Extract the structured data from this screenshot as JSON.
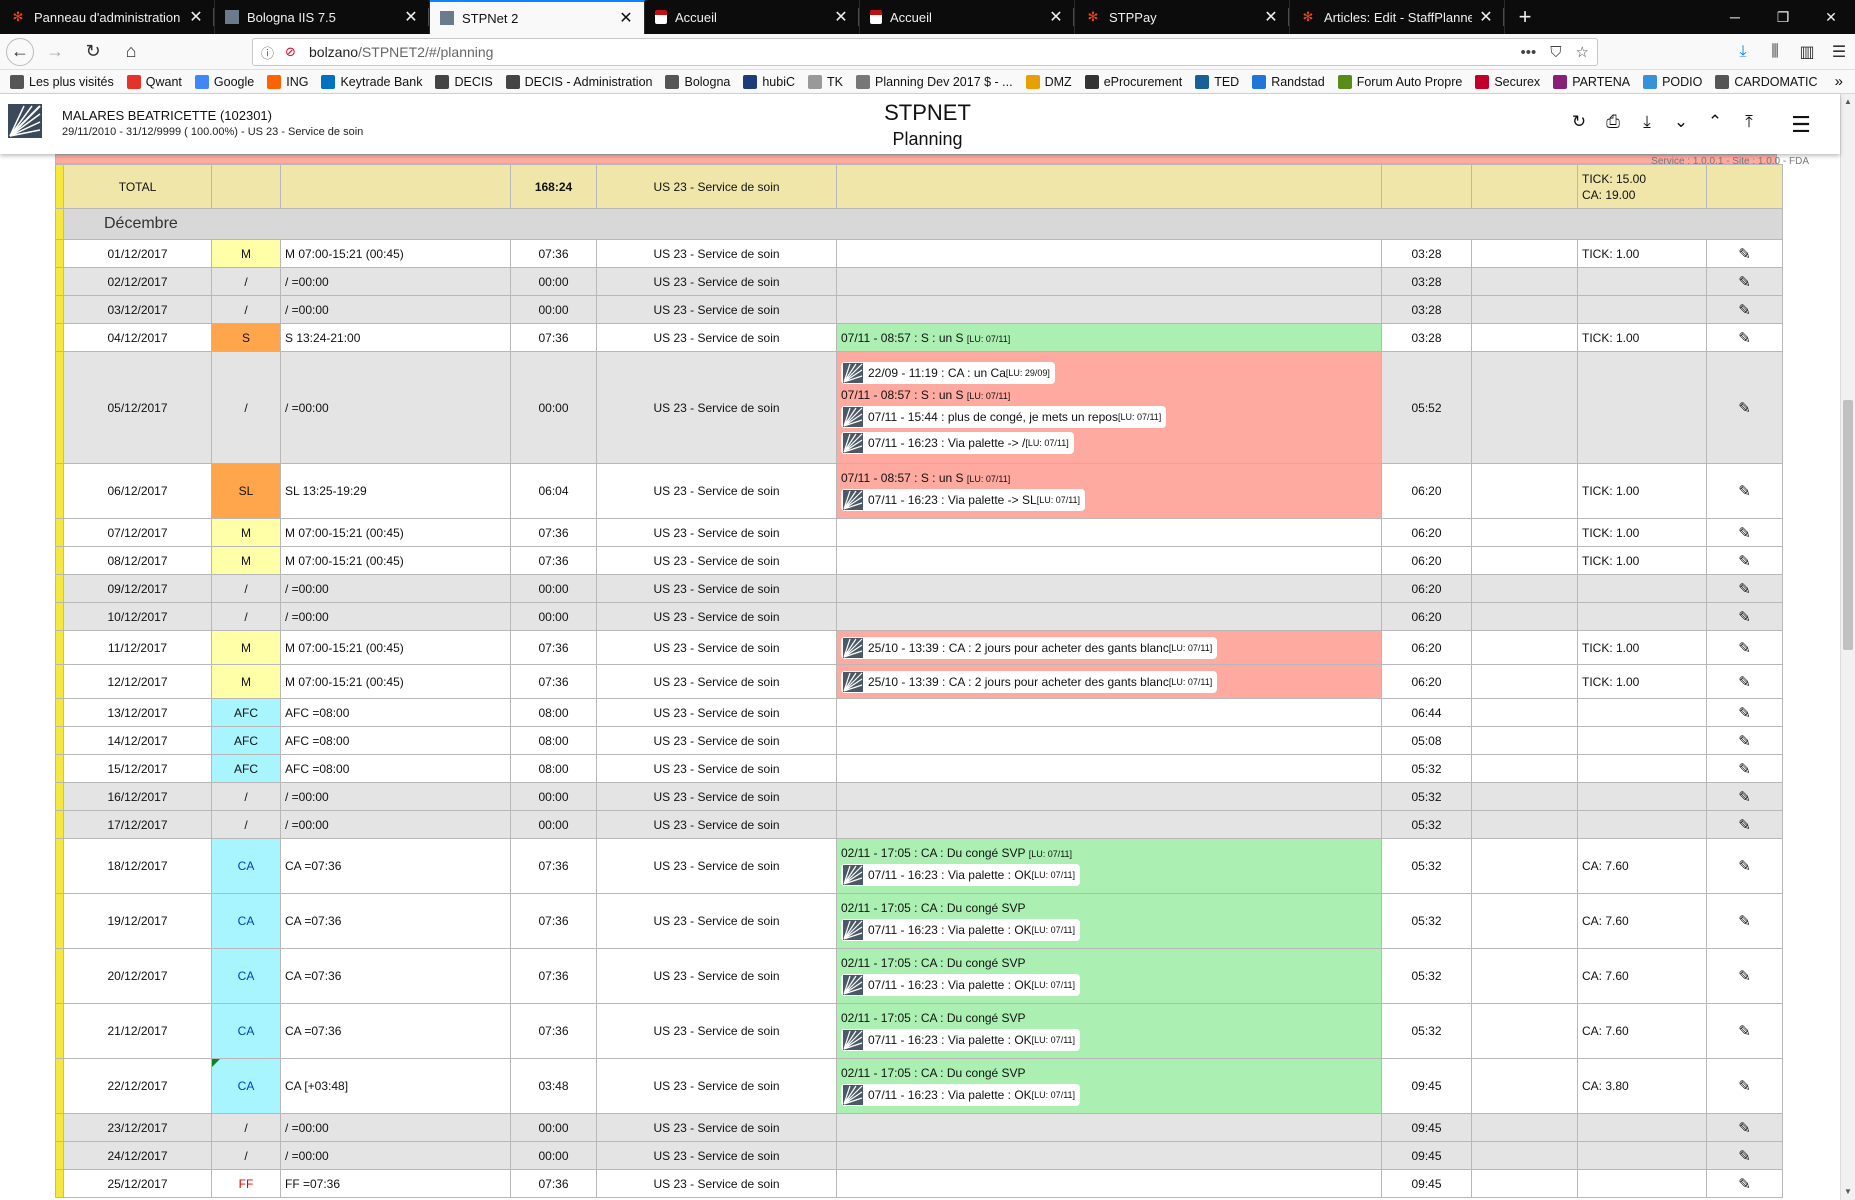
{
  "browser": {
    "tabs": [
      {
        "title": "Panneau d'administration - DEC",
        "icon": "joomla-icon"
      },
      {
        "title": "Bologna IIS 7.5",
        "icon": "bologna-icon"
      },
      {
        "title": "STPNet 2",
        "icon": "stpnet-icon",
        "active": true
      },
      {
        "title": "Accueil",
        "icon": "page-icon"
      },
      {
        "title": "Accueil",
        "icon": "page-icon"
      },
      {
        "title": "STPPay",
        "icon": "joomla-icon"
      },
      {
        "title": "Articles: Edit - StaffPlanner - Ad",
        "icon": "joomla-icon"
      }
    ],
    "url": "bolzano/STPNET2/#/planning",
    "url_host": "bolzano",
    "url_path": "/STPNET2/#/planning",
    "bookmarks": [
      {
        "label": "Les plus visités",
        "color": "#555"
      },
      {
        "label": "Qwant",
        "color": "#e6332a"
      },
      {
        "label": "Google",
        "color": "#4285f4"
      },
      {
        "label": "ING",
        "color": "#ff6200"
      },
      {
        "label": "Keytrade Bank",
        "color": "#0070c0"
      },
      {
        "label": "DECIS",
        "color": "#444"
      },
      {
        "label": "DECIS - Administration",
        "color": "#444"
      },
      {
        "label": "Bologna",
        "color": "#555"
      },
      {
        "label": "hubiC",
        "color": "#1e3a78"
      },
      {
        "label": "TK",
        "color": "#999"
      },
      {
        "label": "Planning Dev 2017 $ - ...",
        "color": "#777"
      },
      {
        "label": "DMZ",
        "color": "#e8a000"
      },
      {
        "label": "eProcurement",
        "color": "#333"
      },
      {
        "label": "TED",
        "color": "#1a5e9a"
      },
      {
        "label": "Randstad",
        "color": "#2175d9"
      },
      {
        "label": "Forum Auto Propre",
        "color": "#5a8a1a"
      },
      {
        "label": "Securex",
        "color": "#c0002a"
      },
      {
        "label": "PARTENA",
        "color": "#8a1f7a"
      },
      {
        "label": "PODIO",
        "color": "#3a8fd9"
      },
      {
        "label": "CARDOMATIC",
        "color": "#555"
      }
    ]
  },
  "header": {
    "employee_name": "MALARES BEATRICETTE (102301)",
    "employee_info": "29/11/2010 - 31/12/9999 ( 100.00%) - US 23 - Service de soin",
    "title": "STPNET",
    "subtitle": "Planning",
    "version": "Service : 1.0.0.1 - Site : 1.0.0 - FDA"
  },
  "total": {
    "label": "TOTAL",
    "hours": "168:24",
    "service": "US 23 - Service de soin",
    "balance_line1": "TICK: 15.00",
    "balance_line2": "CA: 19.00"
  },
  "month": "Décembre",
  "rows": [
    {
      "date": "01/12/2017",
      "code": "M",
      "schedule": "M 07:00-15:21 (00:45)",
      "hours": "07:36",
      "service": "US 23 - Service de soin",
      "comments": [],
      "counter": "03:28",
      "balance": "TICK: 1.00"
    },
    {
      "date": "02/12/2017",
      "code": "/",
      "schedule": "/ =00:00",
      "hours": "00:00",
      "service": "US 23 - Service de soin",
      "comments": [],
      "counter": "03:28",
      "balance": ""
    },
    {
      "date": "03/12/2017",
      "code": "/",
      "schedule": "/ =00:00",
      "hours": "00:00",
      "service": "US 23 - Service de soin",
      "comments": [],
      "counter": "03:28",
      "balance": ""
    },
    {
      "date": "04/12/2017",
      "code": "S",
      "schedule": "S 13:24-21:00",
      "hours": "07:36",
      "service": "US 23 - Service de soin",
      "comments": [
        {
          "text": "07/11 - 08:57 : S : un S",
          "lu": "[LU: 07/11]",
          "pill": false
        }
      ],
      "counter": "03:28",
      "balance": "TICK: 1.00"
    },
    {
      "date": "05/12/2017",
      "code": "/",
      "schedule": "/ =00:00",
      "hours": "00:00",
      "service": "US 23 - Service de soin",
      "comments": [
        {
          "text": "22/09 - 11:19 : CA : un Ca",
          "lu": "[LU: 29/09]",
          "pill": true
        },
        {
          "text": "07/11 - 08:57 : S : un S",
          "lu": "[LU: 07/11]",
          "pill": false
        },
        {
          "text": "07/11 - 15:44 : plus de congé, je mets un repos",
          "lu": "[LU: 07/11]",
          "pill": true
        },
        {
          "text": "07/11 - 16:23 : Via palette -> /",
          "lu": "[LU: 07/11]",
          "pill": true
        }
      ],
      "counter": "05:52",
      "balance": ""
    },
    {
      "date": "06/12/2017",
      "code": "SL",
      "schedule": "SL 13:25-19:29",
      "hours": "06:04",
      "service": "US 23 - Service de soin",
      "comments": [
        {
          "text": "07/11 - 08:57 : S : un S",
          "lu": "[LU: 07/11]",
          "pill": false
        },
        {
          "text": "07/11 - 16:23 : Via palette -> SL",
          "lu": "[LU: 07/11]",
          "pill": true
        }
      ],
      "counter": "06:20",
      "balance": "TICK: 1.00"
    },
    {
      "date": "07/12/2017",
      "code": "M",
      "schedule": "M 07:00-15:21 (00:45)",
      "hours": "07:36",
      "service": "US 23 - Service de soin",
      "comments": [],
      "counter": "06:20",
      "balance": "TICK: 1.00"
    },
    {
      "date": "08/12/2017",
      "code": "M",
      "schedule": "M 07:00-15:21 (00:45)",
      "hours": "07:36",
      "service": "US 23 - Service de soin",
      "comments": [],
      "counter": "06:20",
      "balance": "TICK: 1.00"
    },
    {
      "date": "09/12/2017",
      "code": "/",
      "schedule": "/ =00:00",
      "hours": "00:00",
      "service": "US 23 - Service de soin",
      "comments": [],
      "counter": "06:20",
      "balance": ""
    },
    {
      "date": "10/12/2017",
      "code": "/",
      "schedule": "/ =00:00",
      "hours": "00:00",
      "service": "US 23 - Service de soin",
      "comments": [],
      "counter": "06:20",
      "balance": ""
    },
    {
      "date": "11/12/2017",
      "code": "M",
      "schedule": "M 07:00-15:21 (00:45)",
      "hours": "07:36",
      "service": "US 23 - Service de soin",
      "comments": [
        {
          "text": "25/10 - 13:39 : CA : 2 jours pour acheter des gants blanc",
          "lu": "[LU: 07/11]",
          "pill": true
        }
      ],
      "counter": "06:20",
      "balance": "TICK: 1.00"
    },
    {
      "date": "12/12/2017",
      "code": "M",
      "schedule": "M 07:00-15:21 (00:45)",
      "hours": "07:36",
      "service": "US 23 - Service de soin",
      "comments": [
        {
          "text": "25/10 - 13:39 : CA : 2 jours pour acheter des gants blanc",
          "lu": "[LU: 07/11]",
          "pill": true
        }
      ],
      "counter": "06:20",
      "balance": "TICK: 1.00"
    },
    {
      "date": "13/12/2017",
      "code": "AFC",
      "schedule": "AFC =08:00",
      "hours": "08:00",
      "service": "US 23 - Service de soin",
      "comments": [],
      "counter": "06:44",
      "balance": ""
    },
    {
      "date": "14/12/2017",
      "code": "AFC",
      "schedule": "AFC =08:00",
      "hours": "08:00",
      "service": "US 23 - Service de soin",
      "comments": [],
      "counter": "05:08",
      "balance": ""
    },
    {
      "date": "15/12/2017",
      "code": "AFC",
      "schedule": "AFC =08:00",
      "hours": "08:00",
      "service": "US 23 - Service de soin",
      "comments": [],
      "counter": "05:32",
      "balance": ""
    },
    {
      "date": "16/12/2017",
      "code": "/",
      "schedule": "/ =00:00",
      "hours": "00:00",
      "service": "US 23 - Service de soin",
      "comments": [],
      "counter": "05:32",
      "balance": ""
    },
    {
      "date": "17/12/2017",
      "code": "/",
      "schedule": "/ =00:00",
      "hours": "00:00",
      "service": "US 23 - Service de soin",
      "comments": [],
      "counter": "05:32",
      "balance": ""
    },
    {
      "date": "18/12/2017",
      "code": "CA",
      "schedule": "CA =07:36",
      "hours": "07:36",
      "service": "US 23 - Service de soin",
      "comments": [
        {
          "text": "02/11 - 17:05 : CA : Du congé SVP",
          "lu": "[LU: 07/11]",
          "pill": false
        },
        {
          "text": "07/11 - 16:23 : Via palette : OK",
          "lu": "[LU: 07/11]",
          "pill": true
        }
      ],
      "counter": "05:32",
      "balance": "CA: 7.60"
    },
    {
      "date": "19/12/2017",
      "code": "CA",
      "schedule": "CA =07:36",
      "hours": "07:36",
      "service": "US 23 - Service de soin",
      "comments": [
        {
          "text": "02/11 - 17:05 : CA : Du congé SVP",
          "lu": "",
          "pill": false
        },
        {
          "text": "07/11 - 16:23 : Via palette : OK",
          "lu": "[LU: 07/11]",
          "pill": true
        }
      ],
      "counter": "05:32",
      "balance": "CA: 7.60"
    },
    {
      "date": "20/12/2017",
      "code": "CA",
      "schedule": "CA =07:36",
      "hours": "07:36",
      "service": "US 23 - Service de soin",
      "comments": [
        {
          "text": "02/11 - 17:05 : CA : Du congé SVP",
          "lu": "",
          "pill": false
        },
        {
          "text": "07/11 - 16:23 : Via palette : OK",
          "lu": "[LU: 07/11]",
          "pill": true
        }
      ],
      "counter": "05:32",
      "balance": "CA: 7.60"
    },
    {
      "date": "21/12/2017",
      "code": "CA",
      "schedule": "CA =07:36",
      "hours": "07:36",
      "service": "US 23 - Service de soin",
      "comments": [
        {
          "text": "02/11 - 17:05 : CA : Du congé SVP",
          "lu": "",
          "pill": false
        },
        {
          "text": "07/11 - 16:23 : Via palette : OK",
          "lu": "[LU: 07/11]",
          "pill": true
        }
      ],
      "counter": "05:32",
      "balance": "CA: 7.60"
    },
    {
      "date": "22/12/2017",
      "code": "CA",
      "schedule": "CA [+03:48]",
      "hours": "03:48",
      "service": "US 23 - Service de soin",
      "comments": [
        {
          "text": "02/11 - 17:05 : CA : Du congé SVP",
          "lu": "",
          "pill": false
        },
        {
          "text": "07/11 - 16:23 : Via palette : OK",
          "lu": "[LU: 07/11]",
          "pill": true
        }
      ],
      "counter": "09:45",
      "balance": "CA: 3.80",
      "flag": true
    },
    {
      "date": "23/12/2017",
      "code": "/",
      "schedule": "/ =00:00",
      "hours": "00:00",
      "service": "US 23 - Service de soin",
      "comments": [],
      "counter": "09:45",
      "balance": ""
    },
    {
      "date": "24/12/2017",
      "code": "/",
      "schedule": "/ =00:00",
      "hours": "00:00",
      "service": "US 23 - Service de soin",
      "comments": [],
      "counter": "09:45",
      "balance": ""
    },
    {
      "date": "25/12/2017",
      "code": "FF",
      "schedule": "FF =07:36",
      "hours": "07:36",
      "service": "US 23 - Service de soin",
      "comments": [],
      "counter": "09:45",
      "balance": ""
    }
  ],
  "colors": {
    "accent": "#0a84ff",
    "edge": "#f6e83c",
    "total": "#f0e6aa",
    "green": "#abf0b2",
    "red": "#ffaaa0",
    "M": "#ffffa8",
    "S": "#ffa64d",
    "CA": "#a8f4ff"
  }
}
